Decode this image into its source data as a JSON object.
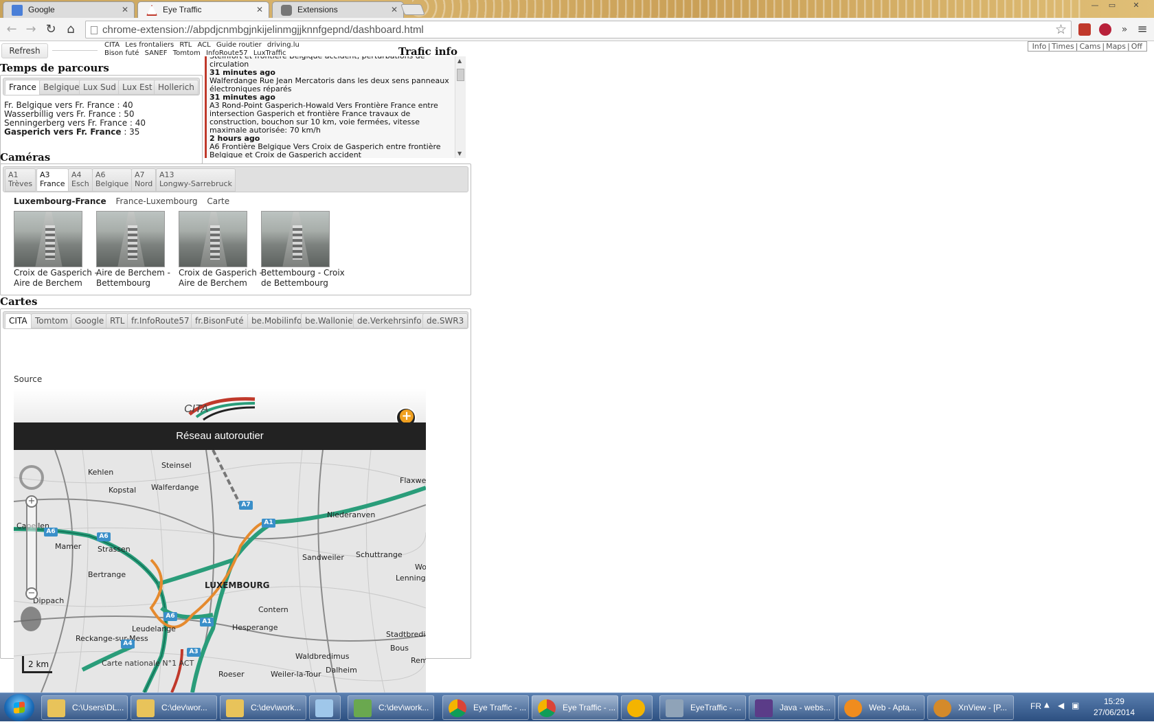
{
  "browser": {
    "tabs": [
      {
        "label": "Google",
        "icon": "google-icon"
      },
      {
        "label": "Eye Traffic",
        "icon": "eye-traffic-icon"
      },
      {
        "label": "Extensions",
        "icon": "puzzle-icon"
      }
    ],
    "url": "chrome-extension://abpdjcnmbgjnkijelinmgjjknnfgepnd/dashboard.html"
  },
  "header": {
    "refresh_label": "Refresh",
    "links_row1": [
      "CITA",
      "Les frontaliers",
      "RTL",
      "ACL",
      "Guide routier",
      "driving.lu"
    ],
    "links_row2": [
      "Bison futé",
      "SANEF",
      "Tomtom",
      "InfoRoute57",
      "LuxTraffic"
    ],
    "trafic_title": "Trafic info",
    "nav": [
      "Info",
      "Times",
      "Cams",
      "Maps",
      "Off"
    ]
  },
  "temps": {
    "title": "Temps de parcours",
    "tabs": [
      "France",
      "Belgique",
      "Lux Sud",
      "Lux Est",
      "Hollerich"
    ],
    "rows": [
      {
        "text": "Fr. Belgique vers Fr. France : 40",
        "bold": false
      },
      {
        "text": "Wasserbillig vers Fr. France : 50",
        "bold": false
      },
      {
        "text": "Senningerberg vers Fr. France : 40",
        "bold": false
      },
      {
        "text": "Gasperich vers Fr. France",
        "value": " : 35",
        "bold": true
      }
    ]
  },
  "news": {
    "items": [
      {
        "text": "Steinfort et frontière Belgique accident, perturbations de circulation",
        "time": "31 minutes ago"
      },
      {
        "text": "Walferdange Rue Jean Mercatoris dans les deux sens panneaux électroniques réparés",
        "time": "31 minutes ago"
      },
      {
        "text": "A3 Rond-Point Gasperich-Howald Vers Frontière France entre intersection Gasperich et frontière France travaux de construction, bouchon sur 10 km, voie fermées, vitesse maximale autorisée: 70 km/h",
        "time": "2 hours ago"
      },
      {
        "text": "A6 Frontière Belgique Vers Croix de Gasperich entre frontière Belgique et Croix de Gasperich accident",
        "time": ""
      }
    ]
  },
  "cameras": {
    "title": "Caméras",
    "tabs": [
      {
        "l1": "A1",
        "l2": "Trèves"
      },
      {
        "l1": "A3",
        "l2": "France"
      },
      {
        "l1": "A4",
        "l2": "Esch"
      },
      {
        "l1": "A6",
        "l2": "Belgique"
      },
      {
        "l1": "A7",
        "l2": "Nord"
      },
      {
        "l1": "A13",
        "l2": "Longwy-Sarrebruck"
      }
    ],
    "directions": [
      "Luxembourg-France",
      "France-Luxembourg",
      "Carte"
    ],
    "feeds": [
      {
        "l1": "Croix de Gasperich -",
        "l2": "Aire de Berchem"
      },
      {
        "l1": "Aire de Berchem -",
        "l2": "Bettembourg"
      },
      {
        "l1": "Croix de Gasperich -",
        "l2": "Aire de Berchem"
      },
      {
        "l1": "Bettembourg - Croix",
        "l2": "de Bettembourg"
      }
    ]
  },
  "cartes": {
    "title": "Cartes",
    "tabs": [
      "CITA",
      "Tomtom",
      "Google",
      "RTL",
      "fr.InfoRoute57",
      "fr.BisonFuté",
      "be.Mobilinfo",
      "be.Wallonie",
      "de.Verkehrsinfo",
      "de.SWR3"
    ],
    "source_label": "Source",
    "logo_text": "CITA",
    "banner": "Réseau autoroutier",
    "scale": "2 km",
    "copyright": "Carte nationale N°1 ACT",
    "places": [
      "Kehlen",
      "Kopstal",
      "Walferdange",
      "Steinsel",
      "Capellen",
      "Mamer",
      "Strassen",
      "Bertrange",
      "LUXEMBOURG",
      "Niederanven",
      "Sandweiler",
      "Schuttrange",
      "Contern",
      "Hesperange",
      "Leudelange",
      "Reckange-sur-Mess",
      "Roeser",
      "Weiler-la-Tour",
      "Waldbredimus",
      "Dalheim",
      "Bous",
      "Stadtbredimus",
      "Dippach",
      "Flaxweiler",
      "Lenninge",
      "Rem",
      "Wo"
    ],
    "roads": [
      "A7",
      "A1",
      "A6",
      "A6",
      "A6",
      "A1",
      "A4",
      "A3",
      "A6"
    ]
  },
  "taskbar": {
    "items": [
      {
        "label": "C:\\Users\\DL...",
        "icon": "folder-icon"
      },
      {
        "label": "C:\\dev\\wor...",
        "icon": "folder-icon"
      },
      {
        "label": "C:\\dev\\work...",
        "icon": "folder-icon"
      },
      {
        "label": "",
        "icon": "notepad-icon"
      },
      {
        "label": "C:\\dev\\work...",
        "icon": "editor-icon"
      },
      {
        "label": "Eye Traffic - ...",
        "icon": "chrome-icon"
      },
      {
        "label": "Eye Traffic - ...",
        "icon": "chrome-icon"
      },
      {
        "label": "",
        "icon": "chrome-canary-icon"
      },
      {
        "label": "EyeTraffic - ...",
        "icon": "app-icon"
      },
      {
        "label": "Java - webs...",
        "icon": "java-ee-icon"
      },
      {
        "label": "Web - Apta...",
        "icon": "gear-icon"
      },
      {
        "label": "XnView - [P...",
        "icon": "xnview-icon"
      }
    ],
    "lang": "FR",
    "time": "15:29",
    "date": "27/06/2014"
  }
}
